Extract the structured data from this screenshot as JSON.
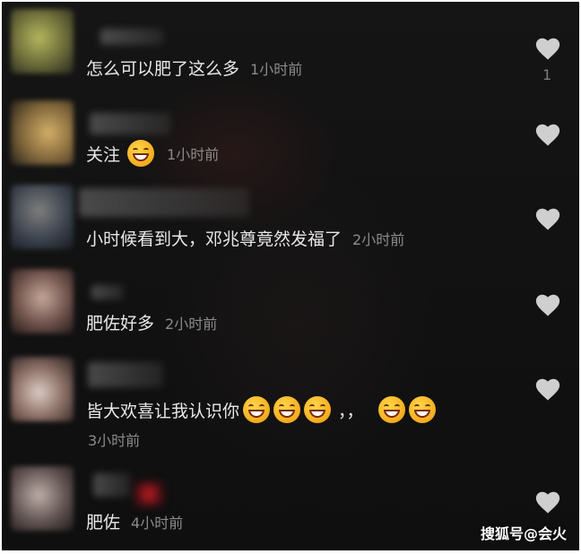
{
  "comments": [
    {
      "text": "怎么可以肥了这么多",
      "time": "1小时前",
      "likes": "1"
    },
    {
      "text": "关注",
      "time": "1小时前"
    },
    {
      "text": "小时候看到大，邓兆尊竟然发福了",
      "time": "2小时前"
    },
    {
      "text": "肥佐好多",
      "time": "2小时前"
    },
    {
      "text": "皆大欢喜让我认识你",
      "punct": "，，",
      "time": "3小时前"
    },
    {
      "text": "肥佐",
      "time": "4小时前"
    }
  ],
  "watermark": "搜狐号@会火",
  "icons": {
    "like": "heart-icon",
    "emoji": "grinning-emoji"
  },
  "colors": {
    "background": "#121212",
    "text": "#e8e8e8",
    "time": "#8b8b8b",
    "heart": "#d0d0d0"
  }
}
